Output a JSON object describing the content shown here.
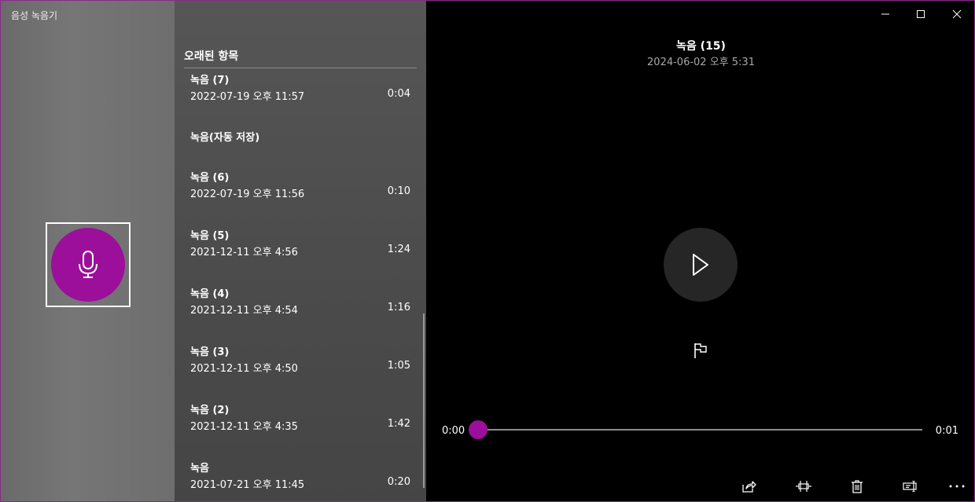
{
  "app": {
    "title": "음성 녹음기"
  },
  "list": {
    "section_header": "오래된 항목",
    "group_header": "녹음(자동 저장)",
    "items": [
      {
        "name": "녹음 (7)",
        "date": "2022-07-19 오후 11:57",
        "duration": "0:04"
      },
      {
        "name": "녹음 (6)",
        "date": "2022-07-19 오후 11:56",
        "duration": "0:10"
      },
      {
        "name": "녹음 (5)",
        "date": "2021-12-11 오후 4:56",
        "duration": "1:24"
      },
      {
        "name": "녹음 (4)",
        "date": "2021-12-11 오후 4:54",
        "duration": "1:16"
      },
      {
        "name": "녹음 (3)",
        "date": "2021-12-11 오후 4:50",
        "duration": "1:05"
      },
      {
        "name": "녹음 (2)",
        "date": "2021-12-11 오후 4:35",
        "duration": "1:42"
      },
      {
        "name": "녹음",
        "date": "2021-07-21 오후 11:45",
        "duration": "0:20"
      }
    ]
  },
  "player": {
    "title": "녹음 (15)",
    "date": "2024-06-02 오후 5:31",
    "current_time": "0:00",
    "total_time": "0:01",
    "progress": 0
  },
  "toolbar": {
    "icons": [
      "share-icon",
      "trim-icon",
      "delete-icon",
      "rename-icon",
      "more-icon"
    ]
  },
  "colors": {
    "accent": "#9b0f9b",
    "window_border": "#8a2a8a",
    "player_bg": "#000000",
    "play_button_bg": "#262626"
  }
}
